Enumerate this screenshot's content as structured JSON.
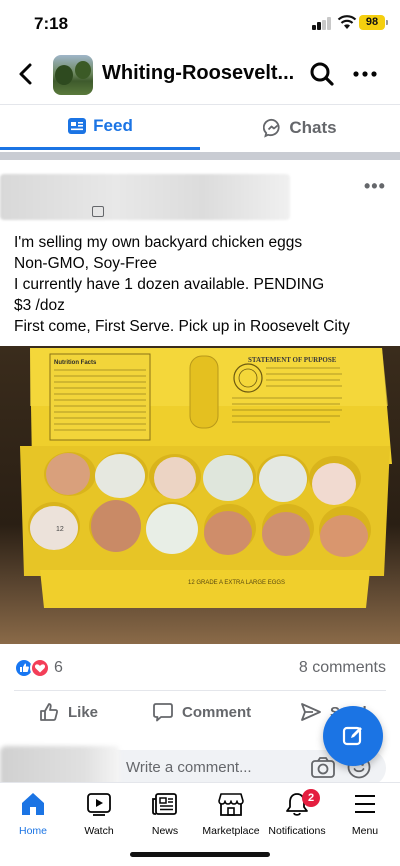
{
  "status_bar": {
    "time": "7:18",
    "battery": "98",
    "battery_color": "#f5cf0f"
  },
  "header": {
    "back_icon": "chevron-left-icon",
    "title": "Whiting-Roosevelt...",
    "search_icon": "search-icon",
    "more_icon": "more-icon"
  },
  "tabs": [
    {
      "label": "Feed",
      "icon": "feed-icon",
      "active": true
    },
    {
      "label": "Chats",
      "icon": "messenger-icon",
      "active": false
    }
  ],
  "post": {
    "more_label": "•••",
    "text_lines": [
      "I'm selling my own backyard chicken eggs",
      "Non-GMO, Soy-Free",
      "I currently have 1 dozen available. PENDING",
      "$3 /doz",
      "First come, First Serve. Pick up in Roosevelt City"
    ],
    "photo": {
      "subject": "egg-carton-photo",
      "carton_heading": "STATEMENT OF PURPOSE",
      "carton_panel": "Nutrition Facts",
      "carton_label": "12 GRADE A EXTRA LARGE EGGS",
      "egg_marking": "12"
    },
    "reaction_count": "6",
    "comment_count": "8 comments",
    "actions": {
      "like": "Like",
      "comment": "Comment",
      "send": "Send"
    }
  },
  "comment_bar": {
    "placeholder": "Write a comment..."
  },
  "bottom_nav": [
    {
      "label": "Home",
      "icon": "home-icon",
      "active": true
    },
    {
      "label": "Watch",
      "icon": "watch-icon",
      "active": false
    },
    {
      "label": "News",
      "icon": "news-icon",
      "active": false
    },
    {
      "label": "Marketplace",
      "icon": "marketplace-icon",
      "active": false
    },
    {
      "label": "Notifications",
      "icon": "bell-icon",
      "active": false,
      "badge": "2"
    },
    {
      "label": "Menu",
      "icon": "menu-icon",
      "active": false
    }
  ],
  "colors": {
    "accent": "#1b74e4",
    "badge": "#e41e3f",
    "like": "#1877f2",
    "love": "#f33e58",
    "carton": "#f2d230"
  }
}
